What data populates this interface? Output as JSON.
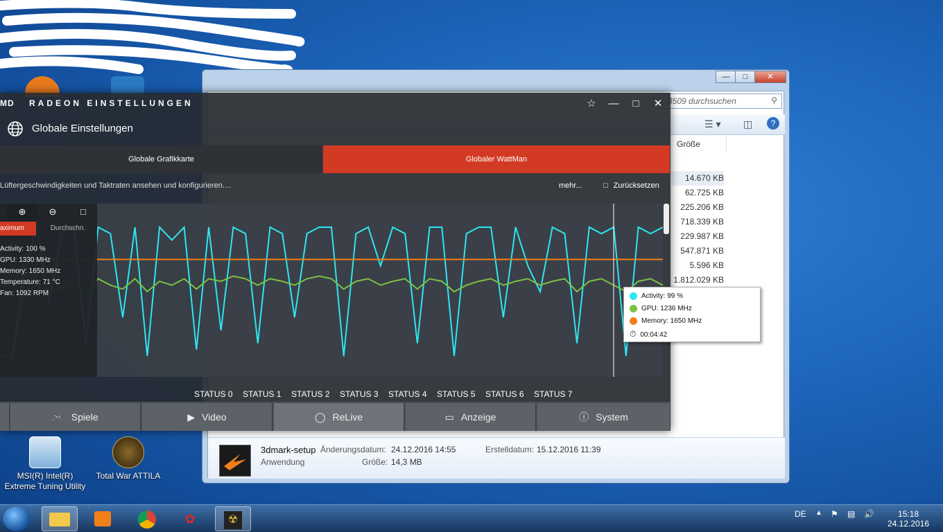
{
  "desktop": {
    "icons": [
      {
        "label": "MSI(R) Intel(R) Extreme Tuning Utility"
      },
      {
        "label": "Total War ATTILA"
      }
    ]
  },
  "explorer": {
    "search_placeholder": "-3509 durchsuchen",
    "column_size": "Größe",
    "sizes": [
      "14.670 KB",
      "62.725 KB",
      "225.206 KB",
      "718.339 KB",
      "229.987 KB",
      "547.871 KB",
      "5.596 KB",
      "1.812.029 KB"
    ],
    "details": {
      "name": "3dmark-setup",
      "type": "Anwendung",
      "modified_label": "Änderungsdatum:",
      "modified_value": "24.12.2016 14:55",
      "size_label": "Größe:",
      "size_value": "14,3 MB",
      "created_label": "Erstelldatum:",
      "created_value": "15.12.2016 11:39"
    }
  },
  "radeon": {
    "title": "RADEON EINSTELLUNGEN",
    "logo": "MD",
    "subtitle": "Globale Einstellungen",
    "tabs": [
      {
        "label": "Globale Grafikkarte",
        "active": false
      },
      {
        "label": "Globaler WattMan",
        "active": true
      }
    ],
    "description": "Lüftergeschwindigkeiten und Taktraten ansehen und konfigurieren....",
    "more": "mehr...",
    "reset": "Zurücksetzen",
    "mode_max": "aximum",
    "mode_avg": "Durchschn.",
    "stats": [
      "Activity: 100 %",
      "GPU: 1330 MHz",
      "Memory: 1650 MHz",
      "Temperature: 71 °C",
      "Fan: 1092 RPM"
    ],
    "states": [
      "STATUS 0",
      "STATUS 1",
      "STATUS 2",
      "STATUS 3",
      "STATUS 4",
      "STATUS 5",
      "STATUS 6",
      "STATUS 7"
    ],
    "bottom_nav": [
      "Spiele",
      "Video",
      "ReLive",
      "Anzeige",
      "System"
    ],
    "tooltip": {
      "activity": "Activity: 99 %",
      "gpu": "GPU: 1236 MHz",
      "memory": "Memory: 1650 MHz",
      "time": "00:04:42"
    },
    "colors": {
      "activity": "#2ee6f0",
      "gpu": "#7cc242",
      "memory": "#f07f1a",
      "accent": "#d33a24"
    }
  },
  "chart_data": {
    "type": "line",
    "series": [
      {
        "name": "Activity",
        "values": [
          0,
          0,
          65,
          100,
          40,
          95,
          100,
          10,
          100,
          95,
          30,
          100,
          0,
          100,
          90,
          100,
          5,
          100,
          20,
          100,
          95,
          10,
          100,
          95,
          30,
          95,
          100,
          100,
          0,
          95,
          100,
          70,
          100,
          95,
          10,
          100,
          100,
          0,
          95,
          100,
          100,
          30,
          100,
          70,
          50,
          100,
          95,
          10,
          100,
          95,
          100,
          0,
          100,
          95,
          100
        ]
      },
      {
        "name": "GPU",
        "values": [
          0,
          0,
          50,
          55,
          50,
          53,
          58,
          48,
          60,
          55,
          52,
          60,
          50,
          58,
          55,
          60,
          52,
          60,
          58,
          62,
          60,
          55,
          60,
          58,
          55,
          60,
          62,
          60,
          52,
          58,
          60,
          55,
          58,
          60,
          52,
          60,
          58,
          50,
          55,
          58,
          60,
          55,
          58,
          60,
          55,
          58,
          60,
          50,
          58,
          60,
          55,
          50,
          58,
          60,
          55
        ]
      },
      {
        "name": "Memory",
        "values": [
          0,
          0,
          75,
          75,
          75,
          75,
          75,
          75,
          75,
          75,
          75,
          75,
          75,
          75,
          75,
          75,
          75,
          75,
          75,
          75,
          75,
          75,
          75,
          75,
          75,
          75,
          75,
          75,
          75,
          75,
          75,
          75,
          75,
          75,
          75,
          75,
          75,
          75,
          75,
          75,
          75,
          75,
          75,
          75,
          75,
          75,
          75,
          75,
          75,
          75,
          75,
          75,
          75,
          75,
          75
        ]
      }
    ],
    "ylim": [
      0,
      100
    ]
  },
  "taskbar": {
    "lang": "DE",
    "time": "15:18",
    "date": "24.12.2016"
  }
}
